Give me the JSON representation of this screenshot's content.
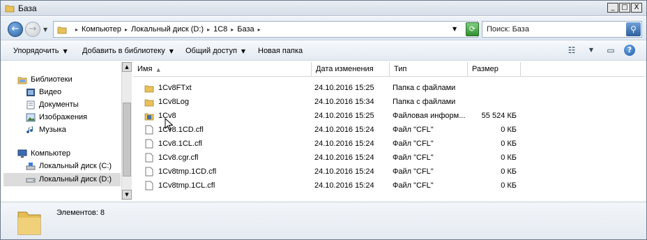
{
  "window": {
    "title": "База"
  },
  "window_buttons": {
    "minimize": "_",
    "maximize": "□",
    "close": "X"
  },
  "address": {
    "breadcrumbs": [
      "Компьютер",
      "Локальный диск (D:)",
      "1C8",
      "База"
    ]
  },
  "search": {
    "placeholder": "Поиск: База"
  },
  "toolbar": {
    "organize": "Упорядочить",
    "add_to_library": "Добавить в библиотеку",
    "share": "Общий доступ",
    "new_folder": "Новая папка"
  },
  "nav": {
    "libraries": "Библиотеки",
    "video": "Видео",
    "documents": "Документы",
    "images": "Изображения",
    "music": "Музыка",
    "computer": "Компьютер",
    "drive_c": "Локальный диск (C:)",
    "drive_d": "Локальный диск (D:)"
  },
  "columns": {
    "name": "Имя",
    "date": "Дата изменения",
    "type": "Тип",
    "size": "Размер"
  },
  "files": [
    {
      "name": "1Cv8FTxt",
      "date": "24.10.2016 15:25",
      "type": "Папка с файлами",
      "size": "",
      "icon": "folder-icon"
    },
    {
      "name": "1Cv8Log",
      "date": "24.10.2016 15:34",
      "type": "Папка с файлами",
      "size": "",
      "icon": "folder-icon"
    },
    {
      "name": "1Cv8",
      "date": "24.10.2016 15:25",
      "type": "Файловая информ...",
      "size": "55 524 КБ",
      "icon": "database-file-icon"
    },
    {
      "name": "1Cv8.1CD.cfl",
      "date": "24.10.2016 15:24",
      "type": "Файл \"CFL\"",
      "size": "0 КБ",
      "icon": "file-icon"
    },
    {
      "name": "1Cv8.1CL.cfl",
      "date": "24.10.2016 15:24",
      "type": "Файл \"CFL\"",
      "size": "0 КБ",
      "icon": "file-icon"
    },
    {
      "name": "1Cv8.cgr.cfl",
      "date": "24.10.2016 15:24",
      "type": "Файл \"CFL\"",
      "size": "0 КБ",
      "icon": "file-icon"
    },
    {
      "name": "1Cv8tmp.1CD.cfl",
      "date": "24.10.2016 15:24",
      "type": "Файл \"CFL\"",
      "size": "0 КБ",
      "icon": "file-icon"
    },
    {
      "name": "1Cv8tmp.1CL.cfl",
      "date": "24.10.2016 15:24",
      "type": "Файл \"CFL\"",
      "size": "0 КБ",
      "icon": "file-icon"
    }
  ],
  "status": {
    "items_count": "Элементов: 8"
  }
}
